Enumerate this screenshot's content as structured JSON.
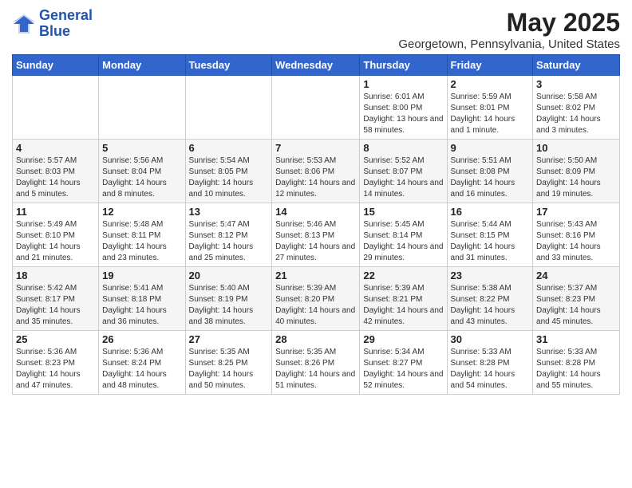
{
  "logo": {
    "line1": "General",
    "line2": "Blue"
  },
  "title": "May 2025",
  "subtitle": "Georgetown, Pennsylvania, United States",
  "days_of_week": [
    "Sunday",
    "Monday",
    "Tuesday",
    "Wednesday",
    "Thursday",
    "Friday",
    "Saturday"
  ],
  "weeks": [
    [
      {
        "day": "",
        "info": ""
      },
      {
        "day": "",
        "info": ""
      },
      {
        "day": "",
        "info": ""
      },
      {
        "day": "",
        "info": ""
      },
      {
        "day": "1",
        "info": "Sunrise: 6:01 AM\nSunset: 8:00 PM\nDaylight: 13 hours\nand 58 minutes."
      },
      {
        "day": "2",
        "info": "Sunrise: 5:59 AM\nSunset: 8:01 PM\nDaylight: 14 hours\nand 1 minute."
      },
      {
        "day": "3",
        "info": "Sunrise: 5:58 AM\nSunset: 8:02 PM\nDaylight: 14 hours\nand 3 minutes."
      }
    ],
    [
      {
        "day": "4",
        "info": "Sunrise: 5:57 AM\nSunset: 8:03 PM\nDaylight: 14 hours\nand 5 minutes."
      },
      {
        "day": "5",
        "info": "Sunrise: 5:56 AM\nSunset: 8:04 PM\nDaylight: 14 hours\nand 8 minutes."
      },
      {
        "day": "6",
        "info": "Sunrise: 5:54 AM\nSunset: 8:05 PM\nDaylight: 14 hours\nand 10 minutes."
      },
      {
        "day": "7",
        "info": "Sunrise: 5:53 AM\nSunset: 8:06 PM\nDaylight: 14 hours\nand 12 minutes."
      },
      {
        "day": "8",
        "info": "Sunrise: 5:52 AM\nSunset: 8:07 PM\nDaylight: 14 hours\nand 14 minutes."
      },
      {
        "day": "9",
        "info": "Sunrise: 5:51 AM\nSunset: 8:08 PM\nDaylight: 14 hours\nand 16 minutes."
      },
      {
        "day": "10",
        "info": "Sunrise: 5:50 AM\nSunset: 8:09 PM\nDaylight: 14 hours\nand 19 minutes."
      }
    ],
    [
      {
        "day": "11",
        "info": "Sunrise: 5:49 AM\nSunset: 8:10 PM\nDaylight: 14 hours\nand 21 minutes."
      },
      {
        "day": "12",
        "info": "Sunrise: 5:48 AM\nSunset: 8:11 PM\nDaylight: 14 hours\nand 23 minutes."
      },
      {
        "day": "13",
        "info": "Sunrise: 5:47 AM\nSunset: 8:12 PM\nDaylight: 14 hours\nand 25 minutes."
      },
      {
        "day": "14",
        "info": "Sunrise: 5:46 AM\nSunset: 8:13 PM\nDaylight: 14 hours\nand 27 minutes."
      },
      {
        "day": "15",
        "info": "Sunrise: 5:45 AM\nSunset: 8:14 PM\nDaylight: 14 hours\nand 29 minutes."
      },
      {
        "day": "16",
        "info": "Sunrise: 5:44 AM\nSunset: 8:15 PM\nDaylight: 14 hours\nand 31 minutes."
      },
      {
        "day": "17",
        "info": "Sunrise: 5:43 AM\nSunset: 8:16 PM\nDaylight: 14 hours\nand 33 minutes."
      }
    ],
    [
      {
        "day": "18",
        "info": "Sunrise: 5:42 AM\nSunset: 8:17 PM\nDaylight: 14 hours\nand 35 minutes."
      },
      {
        "day": "19",
        "info": "Sunrise: 5:41 AM\nSunset: 8:18 PM\nDaylight: 14 hours\nand 36 minutes."
      },
      {
        "day": "20",
        "info": "Sunrise: 5:40 AM\nSunset: 8:19 PM\nDaylight: 14 hours\nand 38 minutes."
      },
      {
        "day": "21",
        "info": "Sunrise: 5:39 AM\nSunset: 8:20 PM\nDaylight: 14 hours\nand 40 minutes."
      },
      {
        "day": "22",
        "info": "Sunrise: 5:39 AM\nSunset: 8:21 PM\nDaylight: 14 hours\nand 42 minutes."
      },
      {
        "day": "23",
        "info": "Sunrise: 5:38 AM\nSunset: 8:22 PM\nDaylight: 14 hours\nand 43 minutes."
      },
      {
        "day": "24",
        "info": "Sunrise: 5:37 AM\nSunset: 8:23 PM\nDaylight: 14 hours\nand 45 minutes."
      }
    ],
    [
      {
        "day": "25",
        "info": "Sunrise: 5:36 AM\nSunset: 8:23 PM\nDaylight: 14 hours\nand 47 minutes."
      },
      {
        "day": "26",
        "info": "Sunrise: 5:36 AM\nSunset: 8:24 PM\nDaylight: 14 hours\nand 48 minutes."
      },
      {
        "day": "27",
        "info": "Sunrise: 5:35 AM\nSunset: 8:25 PM\nDaylight: 14 hours\nand 50 minutes."
      },
      {
        "day": "28",
        "info": "Sunrise: 5:35 AM\nSunset: 8:26 PM\nDaylight: 14 hours\nand 51 minutes."
      },
      {
        "day": "29",
        "info": "Sunrise: 5:34 AM\nSunset: 8:27 PM\nDaylight: 14 hours\nand 52 minutes."
      },
      {
        "day": "30",
        "info": "Sunrise: 5:33 AM\nSunset: 8:28 PM\nDaylight: 14 hours\nand 54 minutes."
      },
      {
        "day": "31",
        "info": "Sunrise: 5:33 AM\nSunset: 8:28 PM\nDaylight: 14 hours\nand 55 minutes."
      }
    ]
  ]
}
